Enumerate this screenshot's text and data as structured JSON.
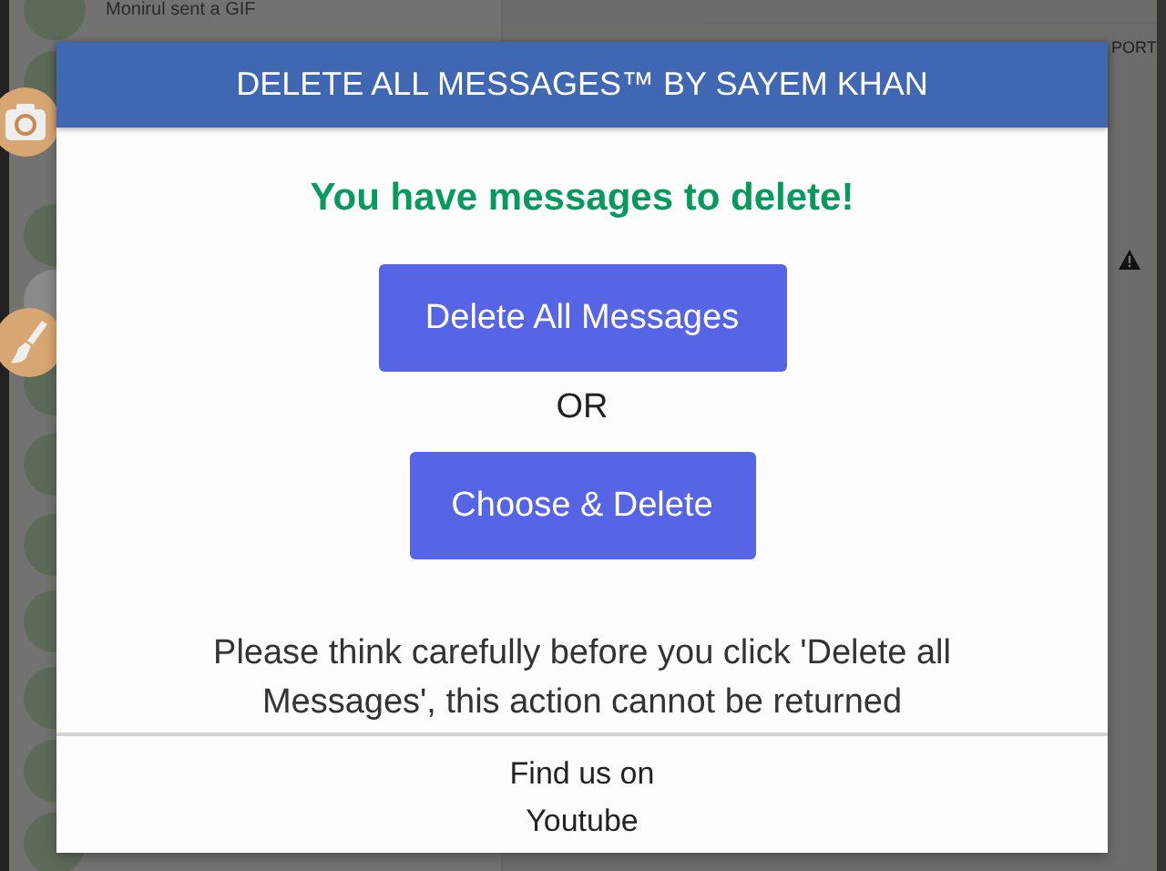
{
  "background": {
    "preview": "Monirul sent a GIF",
    "header_text": "PORT"
  },
  "dialog": {
    "title": "DELETE ALL MESSAGES™ BY SAYEM KHAN",
    "status": "You have messages to delete!",
    "buttons": [
      {
        "label": "Delete All Messages"
      },
      {
        "label": "Choose & Delete"
      }
    ],
    "separator": "OR",
    "warning": "Please think carefully before you click 'Delete all Messages', this action cannot be returned",
    "footer": [
      "Find us on",
      "Youtube"
    ]
  }
}
